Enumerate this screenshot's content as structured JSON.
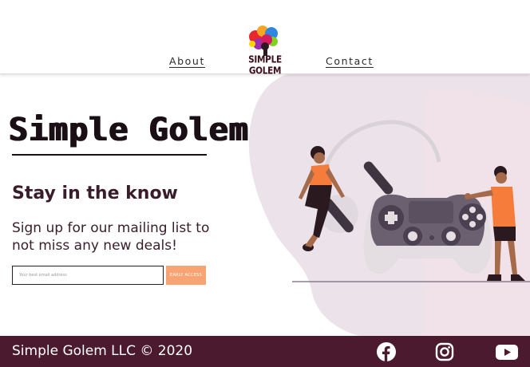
{
  "header": {
    "logo_text": "SIMPLE GOLEM",
    "nav": [
      {
        "label": "About"
      },
      {
        "label": "Contact"
      }
    ]
  },
  "hero": {
    "title": "Simple Golem",
    "subheading": "Stay in the know",
    "tagline": "Sign up for our mailing list to not miss any new deals!"
  },
  "signup": {
    "email_placeholder": "Your best email address",
    "button_label": "EARLY ACCESS"
  },
  "footer": {
    "copyright": "Simple Golem LLC  ©  2020",
    "social_icons": [
      "facebook-icon",
      "instagram-icon",
      "youtube-icon"
    ]
  },
  "colors": {
    "footer_bg": "#4b1a2e",
    "accent": "#f7a372",
    "text_dark": "#2b1b24",
    "blob": "#efe6ec"
  }
}
